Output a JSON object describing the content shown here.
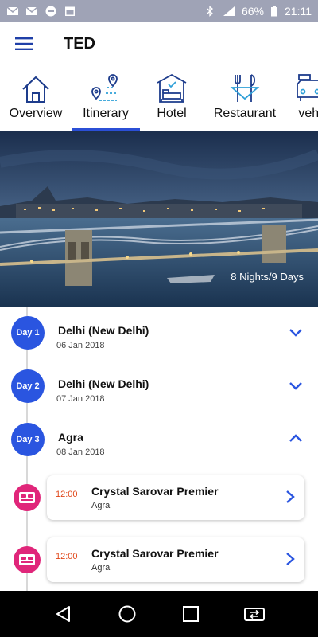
{
  "status_bar": {
    "battery": "66%",
    "time": "21:11",
    "icons": [
      "gmail-icon",
      "gmail-icon",
      "block-icon",
      "calendar-icon",
      "bluetooth-icon",
      "signal-icon",
      "battery-icon"
    ]
  },
  "app_bar": {
    "menu_icon": "hamburger-icon",
    "title": "TED"
  },
  "tabs": [
    {
      "label": "Overview",
      "icon": "house-icon"
    },
    {
      "label": "Itinerary",
      "icon": "route-pin-icon",
      "active": true
    },
    {
      "label": "Hotel",
      "icon": "hotel-building-icon"
    },
    {
      "label": "Restaurant",
      "icon": "cutlery-icon"
    },
    {
      "label": "vehi",
      "icon": "car-icon"
    }
  ],
  "hero": {
    "caption": "8 Nights/9 Days"
  },
  "days": [
    {
      "badge": "Day 1",
      "city": "Delhi (New Delhi)",
      "date": "06 Jan 2018",
      "expanded": false
    },
    {
      "badge": "Day 2",
      "city": "Delhi (New Delhi)",
      "date": "07 Jan 2018",
      "expanded": false
    },
    {
      "badge": "Day 3",
      "city": "Agra",
      "date": "08 Jan 2018",
      "expanded": true
    }
  ],
  "hotels": [
    {
      "time": "12:00",
      "name": "Crystal Sarovar Premier",
      "city": "Agra",
      "icon": "bed-icon"
    },
    {
      "time": "12:00",
      "name": "Crystal Sarovar Premier",
      "city": "Agra",
      "icon": "bed-icon"
    }
  ],
  "colors": {
    "accent": "#2a55e0",
    "hotel_icon_bg": "#e0267a",
    "time": "#e0471a",
    "status_bar": "#9fa3b6"
  },
  "nav_bar": [
    "back-icon",
    "home-icon",
    "recents-icon",
    "switch-app-icon"
  ]
}
